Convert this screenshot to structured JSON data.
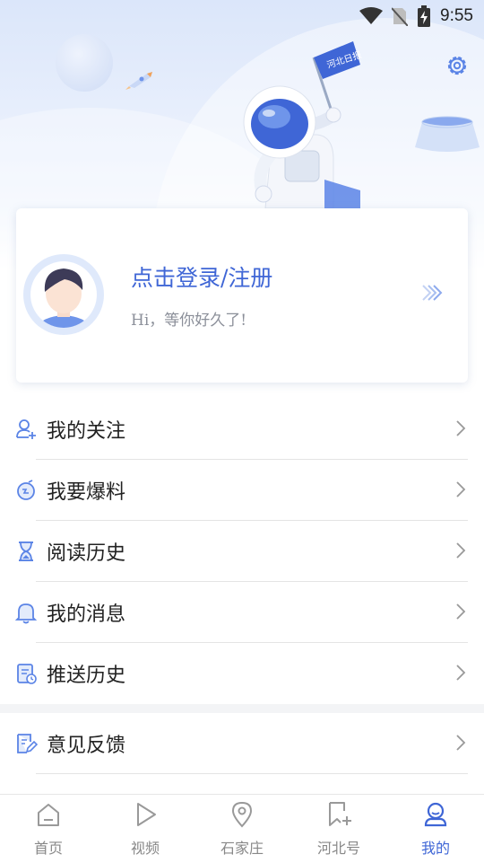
{
  "status_bar": {
    "time": "9:55"
  },
  "header": {
    "flag_text": "河北日报",
    "settings_icon": "gear-icon"
  },
  "login_card": {
    "title": "点击登录/注册",
    "subtitle": "Hi，等你好久了!"
  },
  "menu": {
    "items": [
      {
        "label": "我的关注",
        "icon": "user-follow-icon"
      },
      {
        "label": "我要爆料",
        "icon": "report-icon"
      },
      {
        "label": "阅读历史",
        "icon": "hourglass-icon"
      },
      {
        "label": "我的消息",
        "icon": "bell-icon"
      },
      {
        "label": "推送历史",
        "icon": "push-history-icon"
      }
    ],
    "secondary": [
      {
        "label": "意见反馈",
        "icon": "feedback-icon"
      }
    ]
  },
  "bottom_nav": {
    "items": [
      {
        "label": "首页",
        "icon": "home-icon"
      },
      {
        "label": "视频",
        "icon": "play-icon"
      },
      {
        "label": "石家庄",
        "icon": "location-icon"
      },
      {
        "label": "河北号",
        "icon": "bookmark-add-icon"
      },
      {
        "label": "我的",
        "icon": "profile-icon"
      }
    ],
    "active_index": 4
  },
  "colors": {
    "accent": "#3f66d6",
    "icon_blue": "#5b84e6",
    "text": "#222222",
    "muted": "#8b8f99"
  }
}
